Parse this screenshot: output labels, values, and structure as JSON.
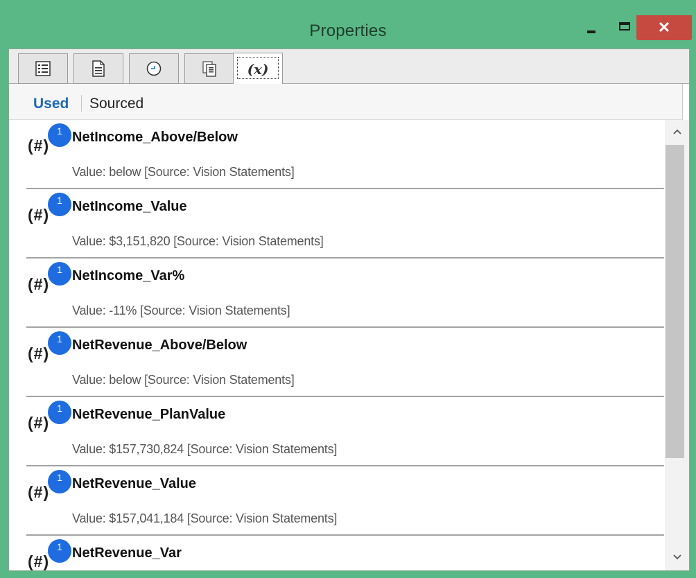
{
  "window": {
    "title": "Properties",
    "close_glyph": "✕"
  },
  "tabs": [
    {
      "icon": "list-view-icon",
      "label": ""
    },
    {
      "icon": "document-icon",
      "label": ""
    },
    {
      "icon": "clock-icon",
      "label": ""
    },
    {
      "icon": "report-icon",
      "label": ""
    },
    {
      "icon": "variable-icon",
      "label": "(x)",
      "active": true
    }
  ],
  "subtabs": {
    "used": "Used",
    "sourced": "Sourced"
  },
  "badge_color": "#1f6ce0",
  "accent_color": "#1e6bb8",
  "items": [
    {
      "hash": "(#)",
      "badge": "1",
      "name": "NetIncome_Above/Below",
      "value": "Value: below [Source: Vision Statements]"
    },
    {
      "hash": "(#)",
      "badge": "1",
      "name": "NetIncome_Value",
      "value": "Value:  $3,151,820  [Source: Vision Statements]"
    },
    {
      "hash": "(#)",
      "badge": "1",
      "name": "NetIncome_Var%",
      "value": "Value: -11% [Source: Vision Statements]"
    },
    {
      "hash": "(#)",
      "badge": "1",
      "name": "NetRevenue_Above/Below",
      "value": "Value: below [Source: Vision Statements]"
    },
    {
      "hash": "(#)",
      "badge": "1",
      "name": "NetRevenue_PlanValue",
      "value": "Value:  $157,730,824  [Source: Vision Statements]"
    },
    {
      "hash": "(#)",
      "badge": "1",
      "name": "NetRevenue_Value",
      "value": "Value:  $157,041,184  [Source: Vision Statements]"
    },
    {
      "hash": "(#)",
      "badge": "1",
      "name": "NetRevenue_Var",
      "value": ""
    }
  ]
}
